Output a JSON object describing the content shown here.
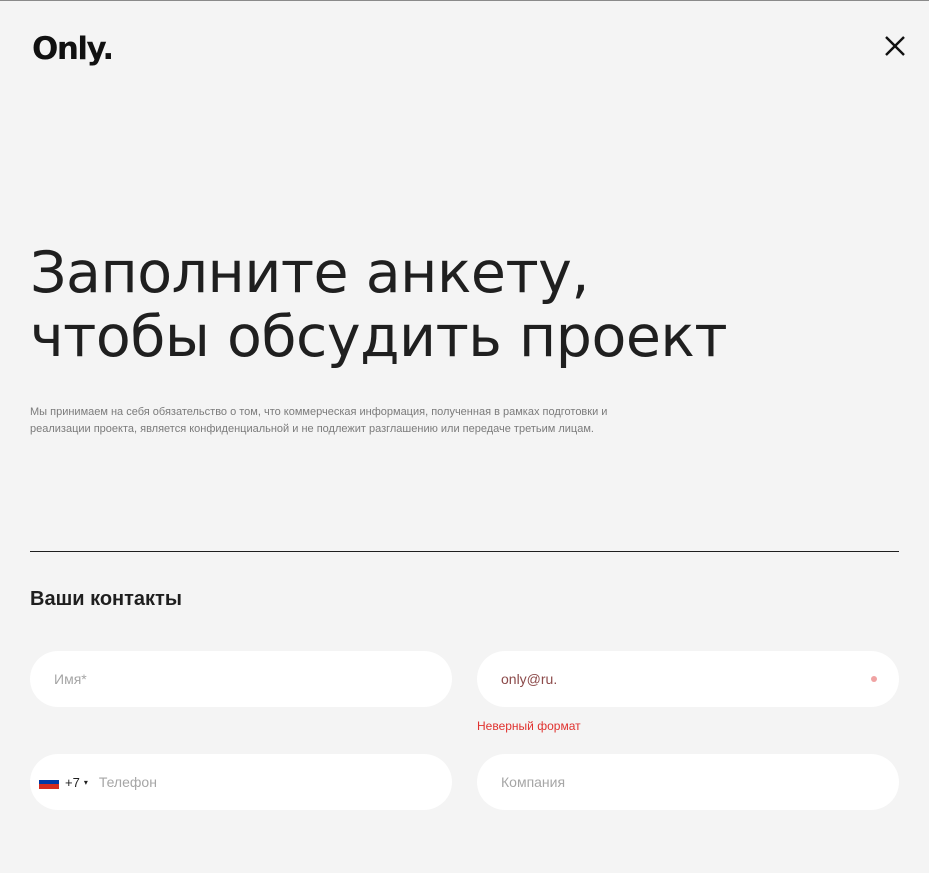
{
  "header": {
    "logo": "Only.",
    "close_icon": "close-icon"
  },
  "hero": {
    "title_line1": "Заполните анкету,",
    "title_line2": "чтобы обсудить проект",
    "disclaimer": "Мы принимаем на себя обязательство о том, что коммерческая информация, полученная в рамках подготовки и реализации проекта, является конфиденциальной и не подлежит разглашению или передаче третьим лицам."
  },
  "contacts": {
    "section_title": "Ваши контакты",
    "name": {
      "value": "",
      "placeholder": "Имя*"
    },
    "email": {
      "value": "only@ru.",
      "error": "Неверный формат"
    },
    "phone": {
      "country_flag": "ru-flag-icon",
      "code": "+7",
      "caret": "▾",
      "value": "",
      "placeholder": "Телефон"
    },
    "company": {
      "value": "",
      "placeholder": "Компания"
    }
  },
  "colors": {
    "background": "#f4f4f4",
    "text": "#1f1f1f",
    "field_bg": "#ffffff",
    "error": "#e0322f",
    "flag_white": "#ffffff",
    "flag_blue": "#0039a6",
    "flag_red": "#d52b1e"
  }
}
